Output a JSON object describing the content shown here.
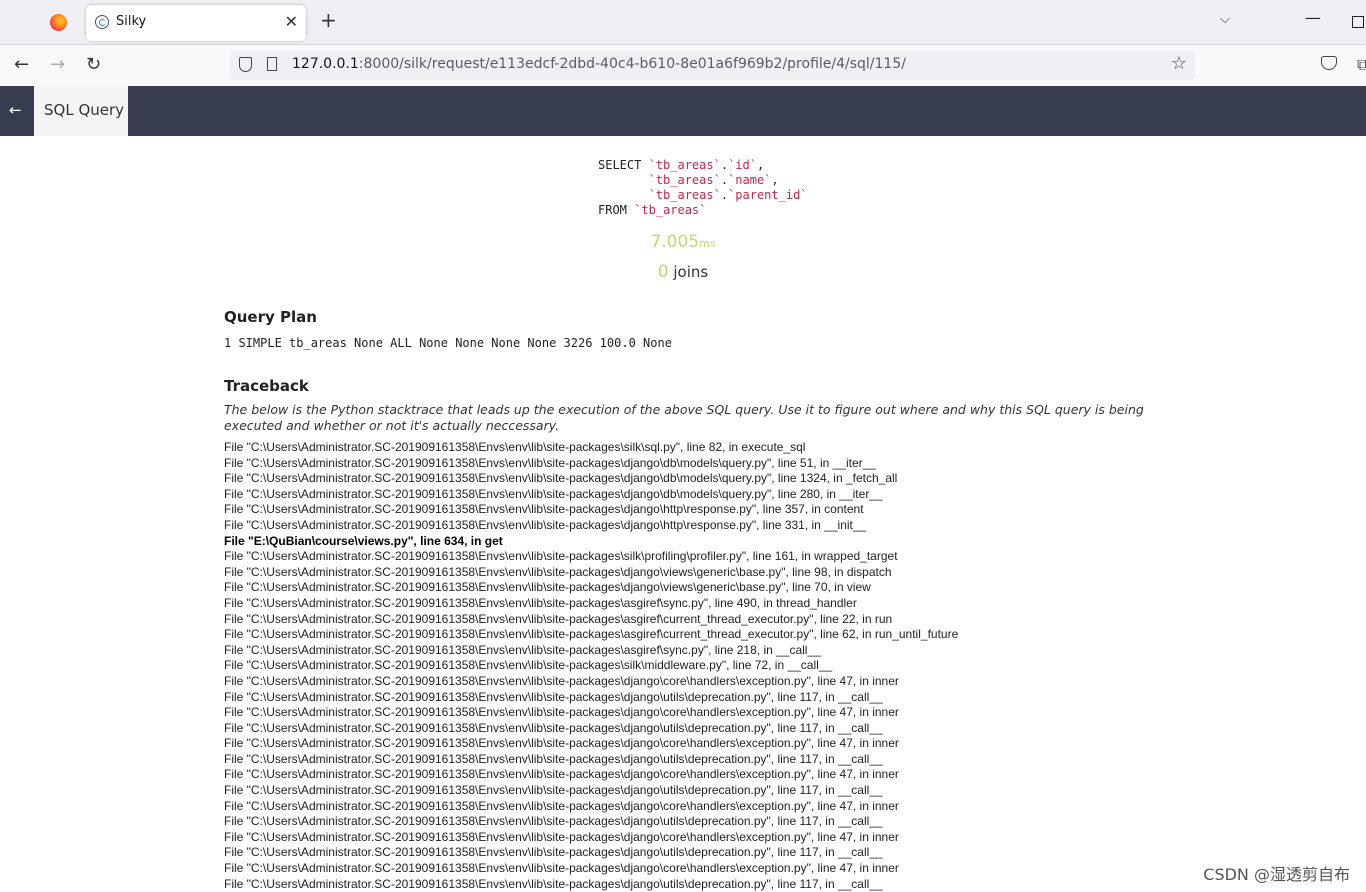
{
  "browser": {
    "tab_title": "Silky",
    "tab_close": "✕",
    "new_tab": "+",
    "tabs_menu": "⌵",
    "url_host": "127.0.0.1",
    "url_rest": ":8000/silk/request/e113edcf-2dbd-40c4-b610-8e01a6f969b2/profile/4/sql/115/",
    "back_icon": "←",
    "forward_icon": "→",
    "reload_icon": "↻",
    "minimize_icon": "—"
  },
  "silk": {
    "back_arrow": "←",
    "tab_label": "SQL Query"
  },
  "sql": {
    "select_kw": "SELECT ",
    "l1_a": "`tb_areas`",
    "l1_dot": ".",
    "l1_b": "`id`",
    "l1_end": ",",
    "indent": "       ",
    "l2_a": "`tb_areas`",
    "l2_dot": ".",
    "l2_b": "`name`",
    "l2_end": ",",
    "l3_a": "`tb_areas`",
    "l3_dot": ".",
    "l3_b": "`parent_id`",
    "from_kw": "FROM ",
    "from_table": "`tb_areas`"
  },
  "stats": {
    "time_value": "7.005",
    "time_unit": "ms",
    "joins_value": "0",
    "joins_label": " joins"
  },
  "query_plan": {
    "heading": "Query Plan",
    "text": "1 SIMPLE tb_areas None ALL None None None None 3226 100.0 None"
  },
  "traceback": {
    "heading": "Traceback",
    "description": "The below is the Python stacktrace that leads up the execution of the above SQL query. Use it to figure out where and why this SQL query is being executed and whether or not it's actually neccessary.",
    "lines": [
      "File \"C:\\Users\\Administrator.SC-201909161358\\Envs\\env\\lib\\site-packages\\silk\\sql.py\", line 82, in execute_sql",
      "File \"C:\\Users\\Administrator.SC-201909161358\\Envs\\env\\lib\\site-packages\\django\\db\\models\\query.py\", line 51, in __iter__",
      "File \"C:\\Users\\Administrator.SC-201909161358\\Envs\\env\\lib\\site-packages\\django\\db\\models\\query.py\", line 1324, in _fetch_all",
      "File \"C:\\Users\\Administrator.SC-201909161358\\Envs\\env\\lib\\site-packages\\django\\db\\models\\query.py\", line 280, in __iter__",
      "File \"C:\\Users\\Administrator.SC-201909161358\\Envs\\env\\lib\\site-packages\\django\\http\\response.py\", line 357, in content",
      "File \"C:\\Users\\Administrator.SC-201909161358\\Envs\\env\\lib\\site-packages\\django\\http\\response.py\", line 331, in __init__",
      "File \"E:\\QuBian\\course\\views.py\", line 634, in get",
      "File \"C:\\Users\\Administrator.SC-201909161358\\Envs\\env\\lib\\site-packages\\silk\\profiling\\profiler.py\", line 161, in wrapped_target",
      "File \"C:\\Users\\Administrator.SC-201909161358\\Envs\\env\\lib\\site-packages\\django\\views\\generic\\base.py\", line 98, in dispatch",
      "File \"C:\\Users\\Administrator.SC-201909161358\\Envs\\env\\lib\\site-packages\\django\\views\\generic\\base.py\", line 70, in view",
      "File \"C:\\Users\\Administrator.SC-201909161358\\Envs\\env\\lib\\site-packages\\asgiref\\sync.py\", line 490, in thread_handler",
      "File \"C:\\Users\\Administrator.SC-201909161358\\Envs\\env\\lib\\site-packages\\asgiref\\current_thread_executor.py\", line 22, in run",
      "File \"C:\\Users\\Administrator.SC-201909161358\\Envs\\env\\lib\\site-packages\\asgiref\\current_thread_executor.py\", line 62, in run_until_future",
      "File \"C:\\Users\\Administrator.SC-201909161358\\Envs\\env\\lib\\site-packages\\asgiref\\sync.py\", line 218, in __call__",
      "File \"C:\\Users\\Administrator.SC-201909161358\\Envs\\env\\lib\\site-packages\\silk\\middleware.py\", line 72, in __call__",
      "File \"C:\\Users\\Administrator.SC-201909161358\\Envs\\env\\lib\\site-packages\\django\\core\\handlers\\exception.py\", line 47, in inner",
      "File \"C:\\Users\\Administrator.SC-201909161358\\Envs\\env\\lib\\site-packages\\django\\utils\\deprecation.py\", line 117, in __call__",
      "File \"C:\\Users\\Administrator.SC-201909161358\\Envs\\env\\lib\\site-packages\\django\\core\\handlers\\exception.py\", line 47, in inner",
      "File \"C:\\Users\\Administrator.SC-201909161358\\Envs\\env\\lib\\site-packages\\django\\utils\\deprecation.py\", line 117, in __call__",
      "File \"C:\\Users\\Administrator.SC-201909161358\\Envs\\env\\lib\\site-packages\\django\\core\\handlers\\exception.py\", line 47, in inner",
      "File \"C:\\Users\\Administrator.SC-201909161358\\Envs\\env\\lib\\site-packages\\django\\utils\\deprecation.py\", line 117, in __call__",
      "File \"C:\\Users\\Administrator.SC-201909161358\\Envs\\env\\lib\\site-packages\\django\\core\\handlers\\exception.py\", line 47, in inner",
      "File \"C:\\Users\\Administrator.SC-201909161358\\Envs\\env\\lib\\site-packages\\django\\utils\\deprecation.py\", line 117, in __call__",
      "File \"C:\\Users\\Administrator.SC-201909161358\\Envs\\env\\lib\\site-packages\\django\\core\\handlers\\exception.py\", line 47, in inner",
      "File \"C:\\Users\\Administrator.SC-201909161358\\Envs\\env\\lib\\site-packages\\django\\utils\\deprecation.py\", line 117, in __call__",
      "File \"C:\\Users\\Administrator.SC-201909161358\\Envs\\env\\lib\\site-packages\\django\\core\\handlers\\exception.py\", line 47, in inner",
      "File \"C:\\Users\\Administrator.SC-201909161358\\Envs\\env\\lib\\site-packages\\django\\utils\\deprecation.py\", line 117, in __call__",
      "File \"C:\\Users\\Administrator.SC-201909161358\\Envs\\env\\lib\\site-packages\\django\\core\\handlers\\exception.py\", line 47, in inner",
      "File \"C:\\Users\\Administrator.SC-201909161358\\Envs\\env\\lib\\site-packages\\django\\utils\\deprecation.py\", line 117, in __call__"
    ],
    "bold_line_index": 6
  },
  "watermark": "CSDN @湿透剪自布"
}
